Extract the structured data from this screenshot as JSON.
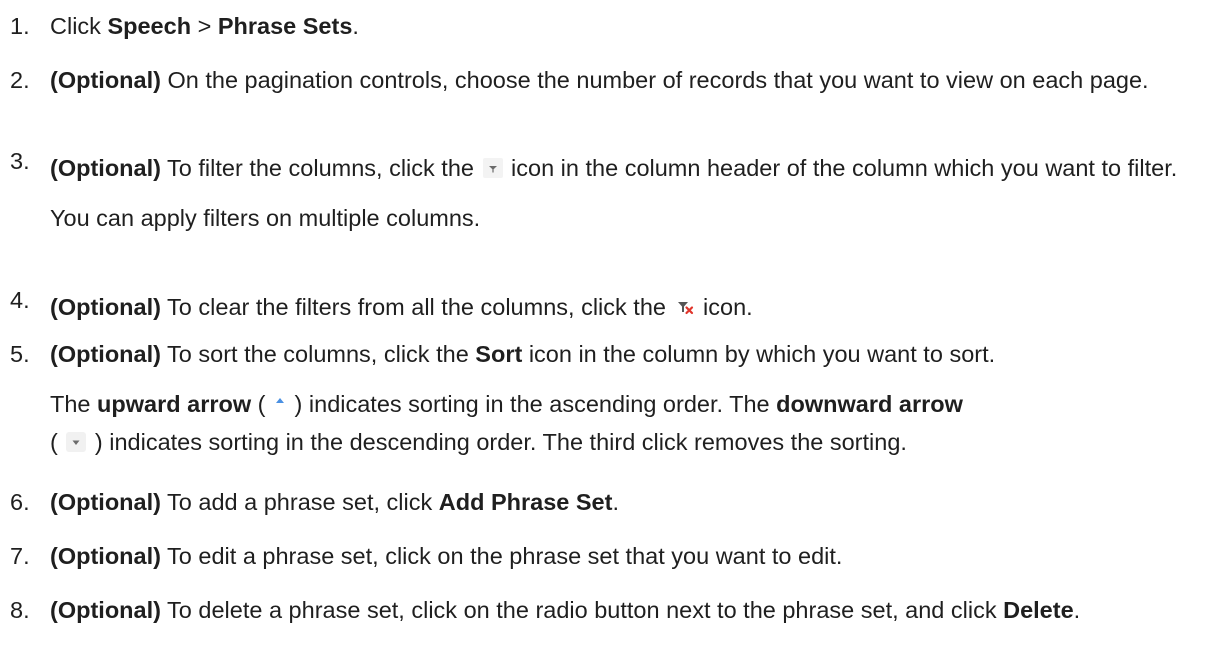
{
  "steps": [
    {
      "number": "1.",
      "text_1": "Click ",
      "bold_1": "Speech",
      "text_2": " > ",
      "bold_2": "Phrase Sets",
      "text_3": "."
    },
    {
      "number": "2.",
      "bold_1": "(Optional)",
      "text_1": " On the pagination controls, choose the number of records that you want to view on each page."
    },
    {
      "number": "3.",
      "bold_1": "(Optional)",
      "text_1": " To filter the columns, click the ",
      "text_2": " icon in the column header of the column which you want to filter.",
      "note": "You can apply filters on multiple columns."
    },
    {
      "number": "4.",
      "bold_1": "(Optional)",
      "text_1": " To clear the filters from all the columns, click the ",
      "text_2": " icon."
    },
    {
      "number": "5.",
      "bold_1": "(Optional)",
      "text_1": " To sort the columns, click the ",
      "bold_2": "Sort",
      "text_2": " icon in the column by which you want to sort.",
      "note_1": "The ",
      "note_bold_1": "upward arrow",
      "note_2": " ( ",
      "note_3": " ) indicates sorting in the ascending order. The ",
      "note_bold_2": "downward arrow",
      "note_4": "( ",
      "note_5": " ) indicates sorting in the descending order. The third click removes the sorting."
    },
    {
      "number": "6.",
      "bold_1": "(Optional)",
      "text_1": " To add a phrase set, click ",
      "bold_2": "Add Phrase Set",
      "text_2": "."
    },
    {
      "number": "7.",
      "bold_1": "(Optional)",
      "text_1": " To edit a phrase set, click on the phrase set that you want to edit."
    },
    {
      "number": "8.",
      "bold_1": "(Optional)",
      "text_1": " To delete a phrase set, click on the radio button next to the phrase set, and click ",
      "bold_2": "Delete",
      "text_2": "."
    }
  ],
  "icons": {
    "filter": "filter-icon",
    "clear_filter": "clear-filter-icon",
    "sort_up": "sort-ascending-icon",
    "sort_down": "sort-descending-icon"
  },
  "colors": {
    "text": "#1f1f1f",
    "icon_gray": "#6b6b6b",
    "icon_blue": "#4a90e2",
    "icon_red": "#e0352b"
  }
}
